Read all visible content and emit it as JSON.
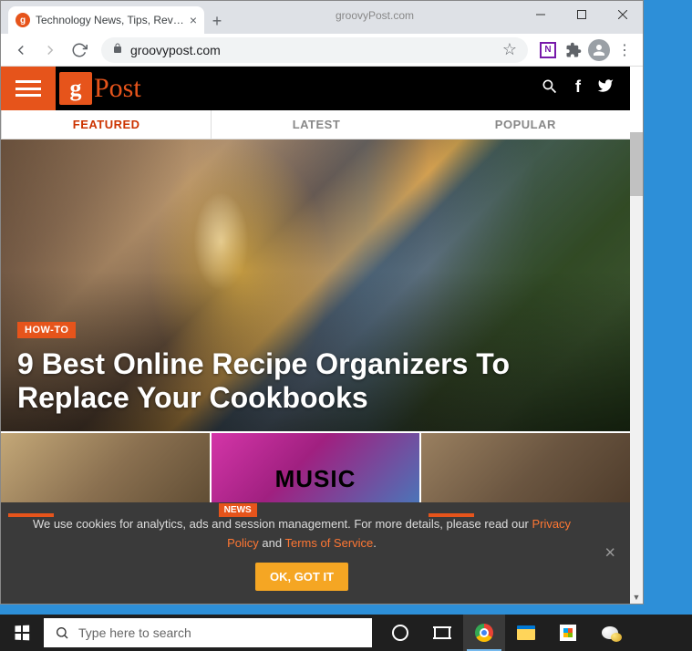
{
  "browser": {
    "tab_title": "Technology News, Tips, Reviews,",
    "title_center": "groovyPost.com",
    "url": "groovypost.com"
  },
  "site": {
    "logo_g": "g",
    "logo_post": "Post",
    "tabs": {
      "featured": "FEATURED",
      "latest": "LATEST",
      "popular": "POPULAR"
    }
  },
  "hero": {
    "badge": "HOW-TO",
    "title": "9 Best Online Recipe Organizers To Replace Your Cookbooks"
  },
  "thumbs": {
    "news_badge": "NEWS",
    "music_text": "MUSIC"
  },
  "cookie": {
    "text1": "We use cookies for analytics, ads and session management. For more details, please read our ",
    "privacy": "Privacy Policy",
    "and": " and ",
    "tos": "Terms of Service",
    "period": ".",
    "button": "OK, GOT IT"
  },
  "taskbar": {
    "search_placeholder": "Type here to search"
  }
}
